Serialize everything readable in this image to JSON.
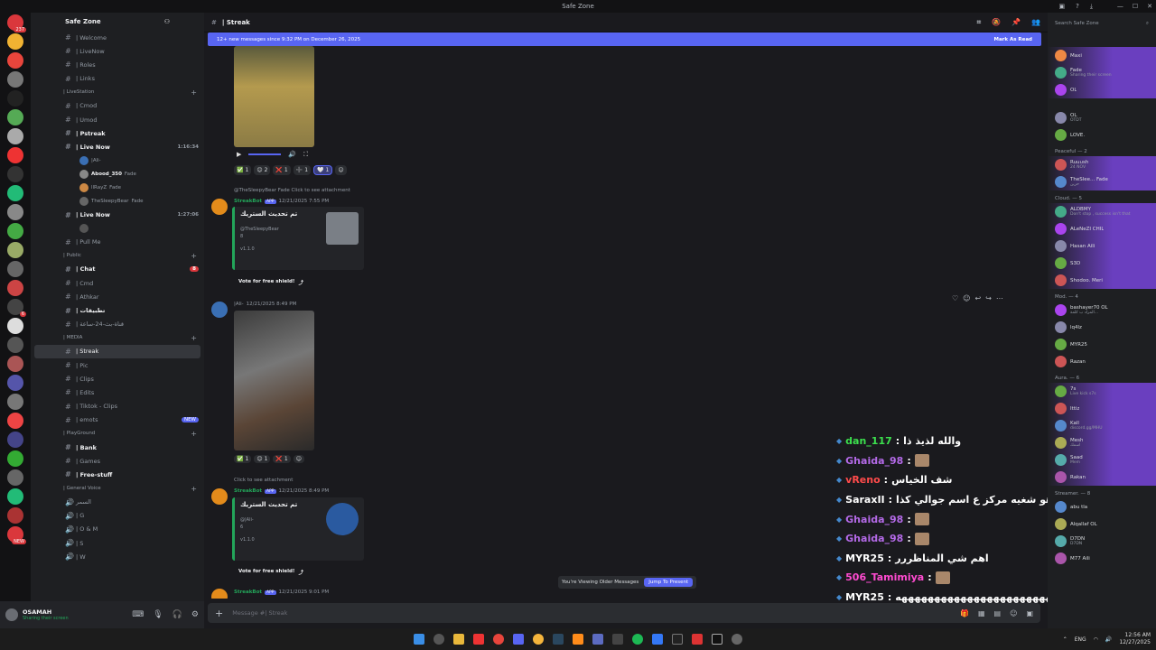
{
  "window": {
    "title": "Safe Zone"
  },
  "servers": [
    {
      "badge": "237"
    },
    {
      "badge": ""
    },
    {
      "badge": ""
    },
    {
      "badge": ""
    },
    {
      "badge": ""
    },
    {
      "badge": ""
    },
    {
      "badge": ""
    },
    {
      "badge": ""
    },
    {
      "badge": ""
    },
    {
      "badge": ""
    },
    {
      "badge": ""
    },
    {
      "badge": ""
    },
    {
      "badge": ""
    },
    {
      "badge": ""
    },
    {
      "badge": ""
    },
    {
      "badge": "6"
    },
    {
      "badge": ""
    },
    {
      "badge": ""
    },
    {
      "badge": ""
    },
    {
      "badge": ""
    },
    {
      "badge": ""
    },
    {
      "badge": ""
    },
    {
      "badge": ""
    },
    {
      "badge": ""
    },
    {
      "badge": ""
    },
    {
      "badge": ""
    },
    {
      "badge": ""
    },
    {
      "badge": "NEW"
    }
  ],
  "sidebar": {
    "guild_name": "Safe Zone",
    "channels_top": [
      "| Welcome",
      "| LiveNow",
      "| Roles",
      "| Links"
    ],
    "cat_livestation": "| LiveStation",
    "livestation": [
      "| Cmod",
      "| Umod",
      "| Pstreak"
    ],
    "live_now_1": {
      "label": "| Live Now",
      "time": "1:16:34"
    },
    "voice_users_1": [
      "|Ali-",
      "Abood_350",
      "llRayZ",
      "TheSleepyBear"
    ],
    "voice_users_1_tags": [
      "Fade",
      "Fade",
      "Fade"
    ],
    "live_now_2": {
      "label": "| Live Now",
      "time": "1:27:06"
    },
    "pull_me": "| Pull Me",
    "cat_public": "| Public",
    "public": [
      "| Chat",
      "| Cmd",
      "| Athkar",
      "| تطبيقات",
      "| قناة-بث-24-ساعة"
    ],
    "public_badge": "8",
    "cat_media": "| MEDIA",
    "media": [
      "| Streak",
      "| Pic",
      "| Clips",
      "| Edits",
      "| Tiktok - Clips",
      "| emots"
    ],
    "media_badge": "NEW",
    "cat_playground": "| PlayGround",
    "playground": [
      "| Bank",
      "| Games",
      "| Free-stuff"
    ],
    "cat_general_voice": "| General Voice",
    "general_voice": [
      "| G",
      "| O & M",
      "| S",
      "| W"
    ],
    "general_voice_top": "السمر"
  },
  "user_panel": {
    "name": "OSAMAH",
    "status": "Sharing their screen"
  },
  "channel": {
    "name": "| Streak",
    "new_messages": "12+ new messages since 9:32 PM on December 26, 2025",
    "mark_as_read": "Mark As Read",
    "composer_placeholder": "Message #| Streak"
  },
  "messages": {
    "reactions_1": [
      "1",
      "2",
      "1",
      "1",
      "1"
    ],
    "msg2_reply": "@TheSleepyBear Fade Click to see attachment",
    "msg2_author": "StreakBot",
    "msg2_app": "APP",
    "msg2_time": "12/21/2025 7:55 PM",
    "embed_title": "تم تحديث الستريك",
    "embed1_user": "@TheSleepyBear",
    "embed1_val": "8",
    "embed_footer": "v1.1.0",
    "vote": "Vote for free shield!",
    "msg3_author": "|Ali-",
    "msg3_time": "12/21/2025 8:49 PM",
    "reactions_3": [
      "1",
      "1",
      "1"
    ],
    "msg4_reply": "Click to see attachment",
    "msg4_time": "12/21/2025 8:49 PM",
    "embed2_user": "@|Ali-",
    "embed2_val": "6",
    "msg5_time": "12/21/2025 9:01 PM",
    "viewing_older": "You're Viewing Older Messages",
    "jump": "Jump To Present"
  },
  "chat_overlay": [
    {
      "user": "dan_117",
      "text": "والله لذيذ ذا",
      "color": "#3ce04e"
    },
    {
      "user": "Ghaida_98",
      "text": "",
      "color": "#b46ae8"
    },
    {
      "user": "vReno",
      "text": "شف الخياس",
      "color": "#ff4b4b"
    },
    {
      "user": "SaraxII",
      "text": "هو شغيه مركز ع اسم جوالي كذا",
      "color": "#ffffff"
    },
    {
      "user": "Ghaida_98",
      "text": "",
      "color": "#b46ae8"
    },
    {
      "user": "Ghaida_98",
      "text": "",
      "color": "#b46ae8"
    },
    {
      "user": "MYR25",
      "text": "اهم شي المناظررر",
      "color": "#ffffff"
    },
    {
      "user": "506_Tamimiya",
      "text": "",
      "color": "#ff4bd1"
    },
    {
      "user": "MYR25",
      "text": "هههههههههههههههههههههههههههههههههه",
      "color": "#ffffff"
    }
  ],
  "members": {
    "search": "Search Safe Zone",
    "live": [
      {
        "name": "Maxi",
        "sub": ""
      },
      {
        "name": "Fade",
        "sub": "Sharing their screen"
      },
      {
        "name": "OL",
        "sub": ""
      }
    ],
    "top": [
      {
        "name": "OL",
        "sub": "OTDT"
      },
      {
        "name": "LOVE.",
        "sub": ""
      }
    ],
    "group_peaceful": "Peaceful — 2",
    "peaceful": [
      {
        "name": "Ruuush",
        "sub": "24 NOV"
      },
      {
        "name": "TheSlee... Fade",
        "sub": "حزين"
      }
    ],
    "group_cloud": "Cloud. — 5",
    "cloud": [
      {
        "name": "ALDBMY",
        "sub": "Don't stop , success isn't that"
      },
      {
        "name": "ALeNeZI CHIL",
        "sub": ""
      },
      {
        "name": "Hasan Aili",
        "sub": ""
      },
      {
        "name": "S3D",
        "sub": ""
      },
      {
        "name": "Shodoo. Meri",
        "sub": ""
      }
    ],
    "group_mod": "Mod. — 4",
    "mod": [
      {
        "name": "bashayer70 OL",
        "sub": "المراد ب كلمة..."
      },
      {
        "name": "lq4lz",
        "sub": ""
      },
      {
        "name": "MYR25",
        "sub": ""
      },
      {
        "name": "Razan",
        "sub": ""
      }
    ],
    "group_aura": "Aura. — 6",
    "aura": [
      {
        "name": "7s",
        "sub": "Live kick s7s"
      },
      {
        "name": "Ittiz",
        "sub": ""
      },
      {
        "name": "Kall",
        "sub": "discord.gg/MHU"
      },
      {
        "name": "Mesh",
        "sub": "اسمك"
      },
      {
        "name": "Saad",
        "sub": "Mem"
      },
      {
        "name": "Rakan",
        "sub": ""
      }
    ],
    "group_streamer": "Streamer. — 8",
    "streamer": [
      {
        "name": "abu tla",
        "sub": ""
      },
      {
        "name": "Alqallaf OL",
        "sub": ""
      },
      {
        "name": "D7DN",
        "sub": "D7DN"
      },
      {
        "name": "M77 Aili",
        "sub": ""
      }
    ]
  },
  "taskbar": {
    "lang": "ENG",
    "time": "12:56 AM",
    "date": "12/27/2025"
  }
}
